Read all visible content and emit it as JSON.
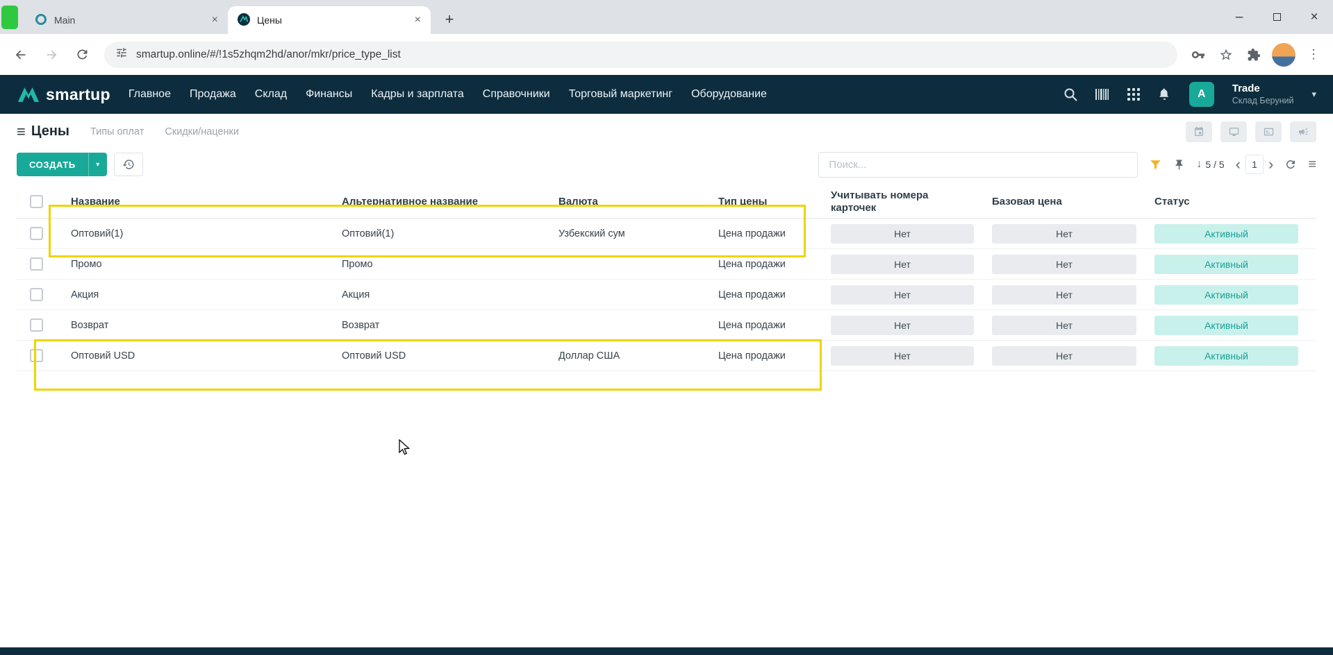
{
  "colors": {
    "accent": "#18a999",
    "header_bg": "#0d2d3e",
    "highlight": "#efd400",
    "status_active_bg": "#c9f1ec",
    "status_active_text": "#17a094",
    "filter": "#f2b32c"
  },
  "icons": {
    "close": "×",
    "plus": "+",
    "minimize": "–",
    "kebab": "⋮",
    "caret_down": "▾",
    "menu": "≡",
    "chevron_left": "‹",
    "chevron_right": "›",
    "arrow_down": "↓"
  },
  "browser": {
    "tabs": [
      {
        "title": "Main"
      },
      {
        "title": "Цены"
      }
    ],
    "url": "smartup.online/#/!1s5zhqm2hd/anor/mkr/price_type_list"
  },
  "app_header": {
    "brand": "smartup",
    "nav": [
      "Главное",
      "Продажа",
      "Склад",
      "Финансы",
      "Кадры и зарплата",
      "Справочники",
      "Торговый маркетинг",
      "Оборудование"
    ],
    "user": {
      "initial": "A",
      "name": "Trade",
      "branch": "Склад Беруний"
    }
  },
  "page": {
    "title": "Цены",
    "links": [
      "Типы оплат",
      "Скидки/наценки"
    ]
  },
  "toolbar": {
    "create": "СОЗДАТЬ",
    "search_placeholder": "Поиск...",
    "counter": "5 / 5",
    "page": "1"
  },
  "table": {
    "columns": [
      "Название",
      "Альтернативное название",
      "Валюта",
      "Тип цены",
      "Учитывать номера карточек",
      "Базовая цена",
      "Статус"
    ],
    "rows": [
      {
        "name": "Оптовий(1)",
        "alt_name": "Оптовий(1)",
        "currency": "Узбекский сум",
        "price_type": "Цена продажи",
        "card_numbers": "Нет",
        "base_price": "Нет",
        "status": "Активный"
      },
      {
        "name": "Промо",
        "alt_name": "Промо",
        "currency": "",
        "price_type": "Цена продажи",
        "card_numbers": "Нет",
        "base_price": "Нет",
        "status": "Активный"
      },
      {
        "name": "Акция",
        "alt_name": "Акция",
        "currency": "",
        "price_type": "Цена продажи",
        "card_numbers": "Нет",
        "base_price": "Нет",
        "status": "Активный"
      },
      {
        "name": "Возврат",
        "alt_name": "Возврат",
        "currency": "",
        "price_type": "Цена продажи",
        "card_numbers": "Нет",
        "base_price": "Нет",
        "status": "Активный"
      },
      {
        "name": "Оптовий USD",
        "alt_name": "Оптовий USD",
        "currency": "Доллар США",
        "price_type": "Цена продажи",
        "card_numbers": "Нет",
        "base_price": "Нет",
        "status": "Активный"
      }
    ]
  }
}
